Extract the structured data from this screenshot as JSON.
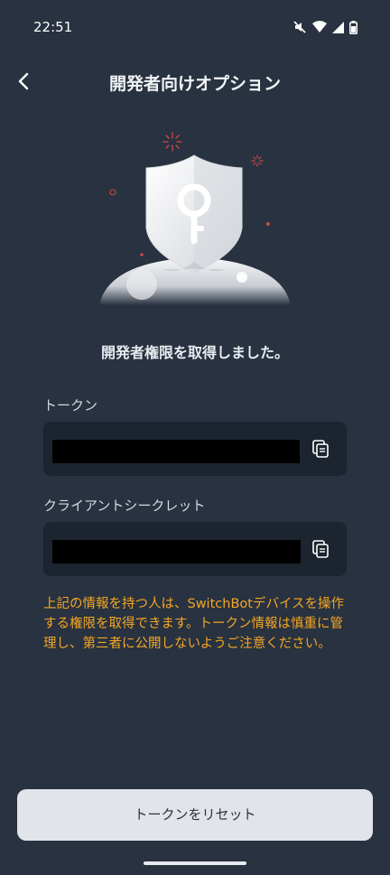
{
  "status_bar": {
    "time": "22:51",
    "icons": [
      "mute-icon",
      "wifi-icon",
      "signal-icon",
      "battery-icon"
    ]
  },
  "header": {
    "back_icon": "chevron-left-icon",
    "title": "開発者向けオプション"
  },
  "illustration": {
    "icon": "shield-key-icon"
  },
  "status_message": "開発者権限を取得しました。",
  "token": {
    "label": "トークン",
    "value": "",
    "copy_icon": "copy-icon"
  },
  "client_secret": {
    "label": "クライアントシークレット",
    "value": "",
    "copy_icon": "copy-icon"
  },
  "warning": "上記の情報を持つ人は、SwitchBotデバイスを操作する権限を取得できます。トークン情報は慎重に管理し、第三者に公開しないようご注意ください。",
  "reset_button": "トークンをリセット",
  "colors": {
    "background": "#283240",
    "field": "#1c2430",
    "warning": "#f5a623",
    "button": "#e1e4e8"
  }
}
